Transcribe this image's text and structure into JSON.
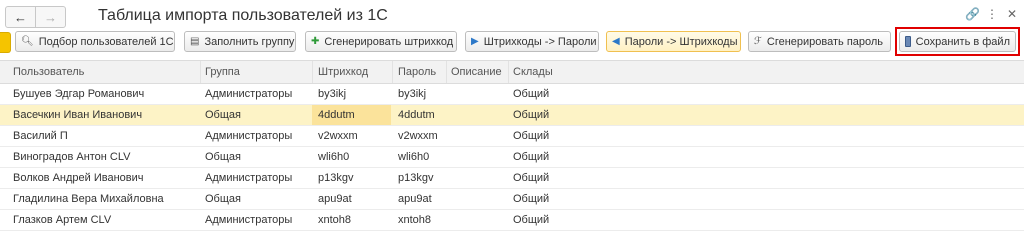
{
  "window": {
    "title": "Таблица импорта пользователей из 1С",
    "nav_back": "←",
    "nav_forward": "→",
    "icon_link": "🔗",
    "icon_menu": "⋮",
    "icon_close": "✕"
  },
  "toolbar": {
    "buttons": [
      {
        "label": "Подбор пользователей 1С",
        "icon": "search-icon"
      },
      {
        "label": "Заполнить группу",
        "icon": "fill-icon"
      },
      {
        "label": "Сгенерировать штрихкод",
        "icon": "generate-barcode-icon"
      },
      {
        "label": "Штрихкоды -> Пароли",
        "icon": "arrow-right-icon"
      },
      {
        "label": "Пароли -> Штрихкоды",
        "icon": "arrow-left-icon"
      },
      {
        "label": "Сгенерировать пароль",
        "icon": "generate-password-icon"
      },
      {
        "label": "Сохранить в файл",
        "icon": "save-icon"
      }
    ]
  },
  "table": {
    "columns": [
      "Пользователь",
      "Группа",
      "Штрихкод",
      "Пароль",
      "Описание",
      "Склады"
    ],
    "rows": [
      {
        "user": "Бушуев Эдгар Романович",
        "group": "Администраторы",
        "barcode": "by3ikj",
        "password": "by3ikj",
        "description": "",
        "warehouses": "Общий"
      },
      {
        "user": "Васечкин Иван Иванович",
        "group": "Общая",
        "barcode": "4ddutm",
        "password": "4ddutm",
        "description": "",
        "warehouses": "Общий"
      },
      {
        "user": "Василий П",
        "group": "Администраторы",
        "barcode": "v2wxxm",
        "password": "v2wxxm",
        "description": "",
        "warehouses": "Общий"
      },
      {
        "user": "Виноградов Антон CLV",
        "group": "Общая",
        "barcode": "wli6h0",
        "password": "wli6h0",
        "description": "",
        "warehouses": "Общий"
      },
      {
        "user": "Волков Андрей Иванович",
        "group": "Администраторы",
        "barcode": "p13kgv",
        "password": "p13kgv",
        "description": "",
        "warehouses": "Общий"
      },
      {
        "user": "Гладилина Вера Михайловна",
        "group": "Общая",
        "barcode": "apu9at",
        "password": "apu9at",
        "description": "",
        "warehouses": "Общий"
      },
      {
        "user": "Глазков Артем CLV",
        "group": "Администраторы",
        "barcode": "xntoh8",
        "password": "xntoh8",
        "description": "",
        "warehouses": "Общий"
      }
    ]
  },
  "colors": {
    "selected_row": "#fdf3c6",
    "active_cell": "#fbe39b",
    "accent": "#f5c400",
    "highlight_frame": "#e00000"
  }
}
